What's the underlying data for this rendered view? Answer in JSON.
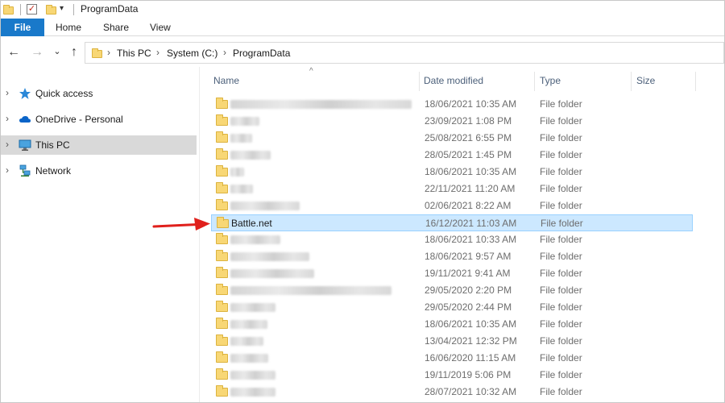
{
  "window": {
    "title": "ProgramData"
  },
  "quick_access": {
    "dropdown_glyph": "▾",
    "check_glyph": "✓"
  },
  "ribbon": {
    "tabs": [
      {
        "label": "File"
      },
      {
        "label": "Home"
      },
      {
        "label": "Share"
      },
      {
        "label": "View"
      }
    ]
  },
  "navigation": {
    "back_glyph": "←",
    "forward_glyph": "→",
    "recent_glyph": "⌄",
    "up_glyph": "↑"
  },
  "address_bar": {
    "breadcrumbs": [
      "This PC",
      "System (C:)",
      "ProgramData"
    ],
    "separator": "›"
  },
  "sidebar": {
    "items": [
      {
        "label": "Quick access",
        "icon": "star-icon"
      },
      {
        "label": "OneDrive - Personal",
        "icon": "cloud-icon"
      },
      {
        "label": "This PC",
        "icon": "computer-icon",
        "selected": true
      },
      {
        "label": "Network",
        "icon": "network-icon"
      }
    ]
  },
  "file_list": {
    "sort_caret": "^",
    "columns": {
      "name": "Name",
      "date_modified": "Date modified",
      "type": "Type",
      "size": "Size"
    },
    "rows": [
      {
        "name": "",
        "date": "18/06/2021 10:35 AM",
        "type": "File folder"
      },
      {
        "name": "",
        "date": "23/09/2021 1:08 PM",
        "type": "File folder"
      },
      {
        "name": "",
        "date": "25/08/2021 6:55 PM",
        "type": "File folder"
      },
      {
        "name": "",
        "date": "28/05/2021 1:45 PM",
        "type": "File folder"
      },
      {
        "name": "",
        "date": "18/06/2021 10:35 AM",
        "type": "File folder"
      },
      {
        "name": "",
        "date": "22/11/2021 11:20 AM",
        "type": "File folder"
      },
      {
        "name": "",
        "date": "02/06/2021 8:22 AM",
        "type": "File folder"
      },
      {
        "name": "Battle.net",
        "date": "16/12/2021 11:03 AM",
        "type": "File folder",
        "selected": true
      },
      {
        "name": "",
        "date": "18/06/2021 10:33 AM",
        "type": "File folder"
      },
      {
        "name": "",
        "date": "18/06/2021 9:57 AM",
        "type": "File folder"
      },
      {
        "name": "",
        "date": "19/11/2021 9:41 AM",
        "type": "File folder"
      },
      {
        "name": "",
        "date": "29/05/2020 2:20 PM",
        "type": "File folder"
      },
      {
        "name": "",
        "date": "29/05/2020 2:44 PM",
        "type": "File folder"
      },
      {
        "name": "",
        "date": "18/06/2021 10:35 AM",
        "type": "File folder"
      },
      {
        "name": "",
        "date": "13/04/2021 12:32 PM",
        "type": "File folder"
      },
      {
        "name": "",
        "date": "16/06/2020 11:15 AM",
        "type": "File folder"
      },
      {
        "name": "",
        "date": "19/11/2019 5:06 PM",
        "type": "File folder"
      },
      {
        "name": "",
        "date": "28/07/2021 10:32 AM",
        "type": "File folder"
      }
    ]
  },
  "colors": {
    "file_tab": "#1979ca",
    "selection_fill": "#cce8ff",
    "selection_border": "#99d1ff",
    "sidebar_selected": "#d9d9d9",
    "folder_yellow": "#f8d775",
    "arrow_red": "#e0201c",
    "column_header_text": "#4c607a"
  }
}
